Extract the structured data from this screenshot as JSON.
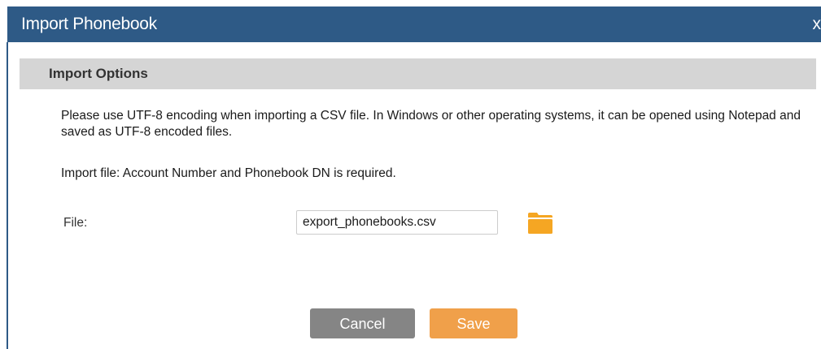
{
  "dialog": {
    "title": "Import Phonebook",
    "close_label": "x"
  },
  "section": {
    "title": "Import Options"
  },
  "notice": {
    "encoding_text": "Please use UTF-8 encoding when importing a CSV file. In Windows or other operating systems, it can be opened using Notepad and saved as UTF-8 encoded files.",
    "required_text": "Import file: Account Number and Phonebook DN is required."
  },
  "file": {
    "label": "File:",
    "value": "export_phonebooks.csv",
    "browse_icon": "folder-icon"
  },
  "buttons": {
    "cancel_label": "Cancel",
    "save_label": "Save"
  },
  "colors": {
    "titlebar": "#2e5a86",
    "section_header": "#d5d5d5",
    "cancel": "#858585",
    "save": "#f0a04a",
    "folder": "#f5a623"
  }
}
